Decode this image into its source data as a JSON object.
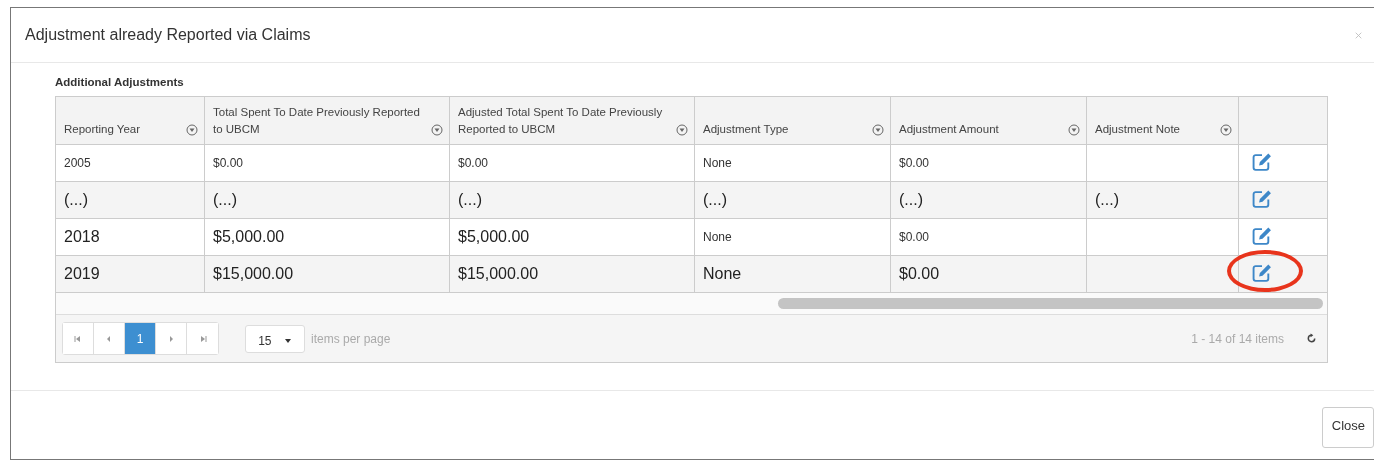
{
  "dialog": {
    "title": "Adjustment already Reported via Claims"
  },
  "section_title": "Additional Adjustments",
  "table": {
    "columns": [
      "Reporting Year",
      "Total Spent To Date Previously Reported to UBCM",
      "Adjusted Total Spent To Date Previously Reported to UBCM",
      "Adjustment Type",
      "Adjustment Amount",
      "Adjustment Note"
    ],
    "rows": [
      {
        "cells": [
          {
            "text": "2005",
            "large": false
          },
          {
            "text": "$0.00",
            "large": false
          },
          {
            "text": "$0.00",
            "large": false
          },
          {
            "text": "None",
            "large": false
          },
          {
            "text": "$0.00",
            "large": false
          },
          null
        ],
        "highlighted": false
      },
      {
        "cells": [
          {
            "text": "(...)",
            "large": true
          },
          {
            "text": "(...)",
            "large": true
          },
          {
            "text": "(...)",
            "large": true
          },
          {
            "text": "(...)",
            "large": true
          },
          {
            "text": "(...)",
            "large": true
          },
          {
            "text": "(...)",
            "large": true
          }
        ],
        "highlighted": false
      },
      {
        "cells": [
          {
            "text": "2018",
            "large": true
          },
          {
            "text": "$5,000.00",
            "large": true
          },
          {
            "text": "$5,000.00",
            "large": true
          },
          {
            "text": "None",
            "large": false
          },
          {
            "text": "$0.00",
            "large": false
          },
          null
        ],
        "highlighted": false
      },
      {
        "cells": [
          {
            "text": "2019",
            "large": true
          },
          {
            "text": "$15,000.00",
            "large": true
          },
          {
            "text": "$15,000.00",
            "large": true
          },
          {
            "text": "None",
            "large": true
          },
          {
            "text": "$0.00",
            "large": true
          },
          null
        ],
        "highlighted": true
      }
    ]
  },
  "pager": {
    "pages": [
      {
        "label": "1",
        "selected": true
      }
    ],
    "page_size": "15",
    "page_size_label": "items per page",
    "summary": "1 - 14 of 14 items"
  },
  "buttons": [
    "Close"
  ]
}
